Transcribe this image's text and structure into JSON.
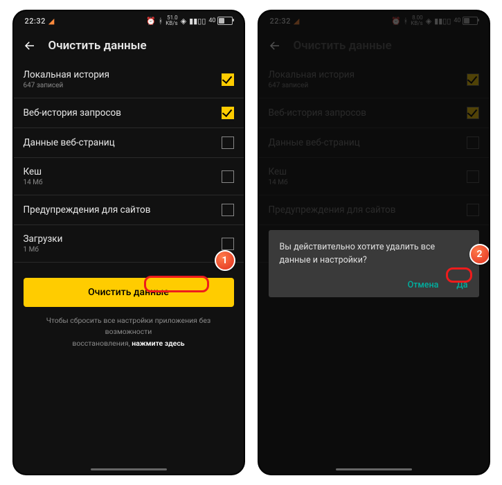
{
  "status": {
    "time": "22:32",
    "net_rate_top": "51.0",
    "net_rate_bottom": "KB/s",
    "net_rate_top_b": "8.00",
    "battery_pct": "40"
  },
  "header": {
    "title": "Очистить данные"
  },
  "rows": [
    {
      "title": "Локальная история",
      "sub": "647 записей",
      "checked": true
    },
    {
      "title": "Веб-история запросов",
      "sub": "",
      "checked": true
    },
    {
      "title": "Данные веб-страниц",
      "sub": "",
      "checked": false
    },
    {
      "title": "Кеш",
      "sub": "14 Мб",
      "checked": false
    },
    {
      "title": "Предупреждения для сайтов",
      "sub": "",
      "checked": false
    },
    {
      "title": "Загрузки",
      "sub": "1 Мб",
      "checked": false
    }
  ],
  "primary_label": "Очистить данные",
  "reset": {
    "line1": "Чтобы сбросить все настройки приложения без возможности",
    "line2_prefix": "восстановления, ",
    "link": "нажмите здесь"
  },
  "dialog": {
    "msg": "Вы действительно хотите удалить все данные и настройки?",
    "cancel": "Отмена",
    "ok": "Да"
  },
  "annotations": {
    "one": "1",
    "two": "2"
  }
}
